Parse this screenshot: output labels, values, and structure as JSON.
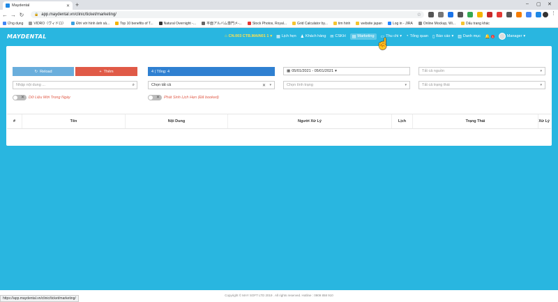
{
  "browser": {
    "tab_title": "Maydental",
    "url": "app.maydental.vn/clinic/ticket/marketing/",
    "status_url": "https://app.maydental.vn/clinic/ticket/marketing/",
    "bookmarks": [
      {
        "label": "Ứng dụng",
        "color": "#4285f4"
      },
      {
        "label": "VIDRO（ヴィドロ）",
        "color": "#999999"
      },
      {
        "label": "Đời với hình ảnh sả...",
        "color": "#3aa0e0"
      },
      {
        "label": "Top 10 benefits of T...",
        "color": "#f4b400"
      },
      {
        "label": "Natural Overnight -...",
        "color": "#333333"
      },
      {
        "label": "平面アルバム専門メ-...",
        "color": "#666666"
      },
      {
        "label": "Stock Photos, Royal...",
        "color": "#e53935"
      },
      {
        "label": "Grid Calculator by...",
        "color": "#f4c430"
      },
      {
        "label": "tim hinh",
        "color": "#f4c430"
      },
      {
        "label": "website japan",
        "color": "#f4c430"
      },
      {
        "label": "Log in - JIRA",
        "color": "#2684ff"
      },
      {
        "label": "Online Mockup, Wi...",
        "color": "#888888"
      },
      {
        "label": "Dấu trang khác",
        "color": "#f4c430"
      }
    ]
  },
  "appbar": {
    "logo": "MAYDENTAL",
    "branch": "CN.003 CTB.MAIN01 1",
    "nav": [
      {
        "icon": "calendar-icon",
        "glyph": "▦",
        "label": "Lịch hẹn"
      },
      {
        "icon": "user-icon",
        "glyph": "♟",
        "label": "Khách hàng"
      },
      {
        "icon": "chat-icon",
        "glyph": "✉",
        "label": "CSKH"
      },
      {
        "icon": "marketing-icon",
        "glyph": "▤",
        "label": "Marketing"
      },
      {
        "icon": "cash-icon",
        "glyph": "▭",
        "label": "Thu chi"
      },
      {
        "icon": "dashboard-icon",
        "glyph": "◔",
        "label": "Tổng quan"
      },
      {
        "icon": "report-icon",
        "glyph": "▯",
        "label": "Báo cáo"
      },
      {
        "icon": "catalog-icon",
        "glyph": "▥",
        "label": "Danh mục"
      }
    ],
    "notification_count": "1",
    "user": "Manager"
  },
  "actions": {
    "reload_label": "Reload",
    "add_label": "Thêm",
    "summary": "4 | Tổng: 4"
  },
  "filters": {
    "date_range": "05/01/2021 - 05/01/2021",
    "source_placeholder": "Tất cả nguồn",
    "search_placeholder": "Nhập nội dung ...",
    "select_all": "Chọn tất cả",
    "condition_placeholder": "Chọn tình trạng",
    "status_placeholder": "Tất cả trạng thái",
    "toggle_today": "Dữ Liệu Mới Trong Ngày",
    "toggle_booked": "Phát Sinh Lịch Hẹn (Đã booked)"
  },
  "table": {
    "columns": [
      "#",
      "Tên",
      "Nội Dung",
      "Người Xử Lý",
      "Lịch",
      "Trạng Thái",
      "Xử Lý"
    ]
  },
  "footer": {
    "copyright": "Copyright © MAY SOFT LTD 2019 . All rights reserved. Hotline : 0909 858 910"
  }
}
